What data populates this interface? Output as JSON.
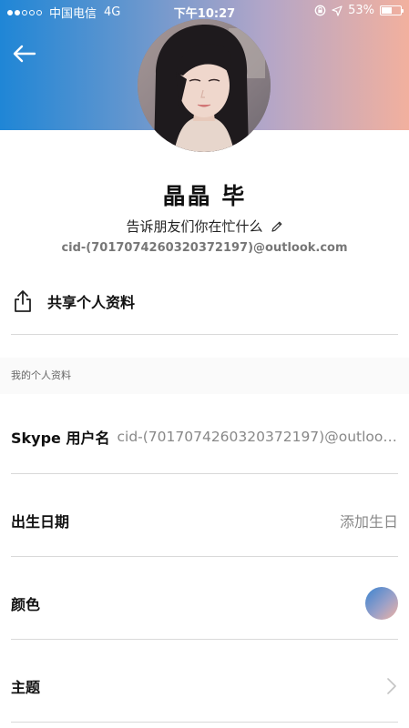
{
  "status_bar": {
    "carrier": "中国电信",
    "network": "4G",
    "time": "下午10:27",
    "battery": "53%",
    "battery_level": 0.53
  },
  "profile": {
    "name": "晶晶 毕",
    "mood": "告诉朋友们你在忙什么",
    "email": "cid-(7017074260320372197)@outlook.com"
  },
  "share": {
    "label": "共享个人资料"
  },
  "section": {
    "title": "我的个人资料"
  },
  "rows": [
    {
      "label": "Skype 用户名",
      "value": "cid-(7017074260320372197)@outlook.com"
    },
    {
      "label": "出生日期",
      "value": "添加生日"
    },
    {
      "label": "颜色"
    },
    {
      "label": "主题"
    }
  ],
  "colors": {
    "header_gradient": [
      "#1f86d6",
      "#b3a6c8",
      "#f2b09e"
    ],
    "swatch_gradient": [
      "#3a83d0",
      "#f0b2a3"
    ]
  }
}
